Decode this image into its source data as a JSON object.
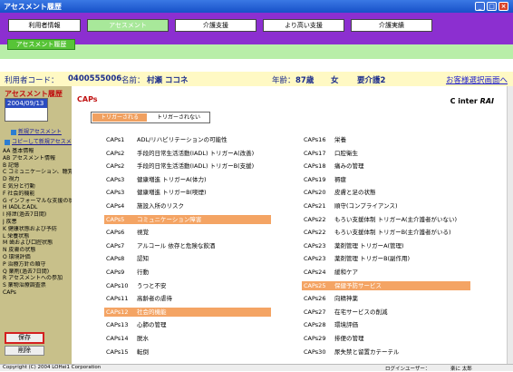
{
  "window": {
    "title": "アセスメント履歴"
  },
  "nav": {
    "items": [
      {
        "label": "利用者情報"
      },
      {
        "label": "アセスメント"
      },
      {
        "label": "介護支援"
      },
      {
        "label": "より高い支援"
      },
      {
        "label": "介護実績"
      }
    ],
    "active": "アセスメント"
  },
  "subnav": {
    "button": "アセスメント履歴"
  },
  "info": {
    "user_code_label": "利用者コード：",
    "user_code": "0400555006",
    "name_label": "名前：",
    "name": "村瀬 ココネ",
    "age_label": "年齢：",
    "age": "87歳",
    "sex": "女",
    "care_level": "要介護2",
    "customer_link": "お客様選択画面へ"
  },
  "sidebar": {
    "title": "アセスメント履歴",
    "date": "2004/09/13",
    "new_link": "新規アセスメント",
    "copy_link": "コピーして新規アセスメント",
    "menu": [
      "AA 基本情報",
      "AB アセスメント情報",
      "B 記憶",
      "C コミュニケーション、聴覚",
      "D 視力",
      "E 気分と行動",
      "F 社会的機能",
      "G インフォーマルな支援の状況",
      "H IADLとADL",
      "I 排泄(過去7日間)",
      "J 疾患",
      "K 健康状態および予防",
      "L 栄養状態",
      "M 歯および口腔状態",
      "N 皮膚の状態",
      "O 環境評価",
      "P 治療方針の順守",
      "Q 薬剤(過去7日間)",
      "R アセスメントへの参加",
      "S 薬物治療調査票",
      "CAPs"
    ],
    "save": "保存",
    "delete": "削除"
  },
  "main": {
    "title": "CAPs",
    "logo": "C inter",
    "logo_suffix": "RAI",
    "toggle": {
      "on": "トリガーされる",
      "off": "トリガーされない"
    },
    "left": [
      {
        "code": "CAPs1",
        "label": "ADL/リハビリテーションの可能性",
        "triggered": false
      },
      {
        "code": "CAPs2",
        "label": "手段的日常生活活動(IADL)  トリガーA(改善)",
        "triggered": false
      },
      {
        "code": "CAPs2",
        "label": "手段的日常生活活動(IADL)  トリガーB(支援)",
        "triggered": false
      },
      {
        "code": "CAPs3",
        "label": "健康増進  トリガーA(体力)",
        "triggered": false
      },
      {
        "code": "CAPs3",
        "label": "健康増進  トリガーB(喫煙)",
        "triggered": false
      },
      {
        "code": "CAPs4",
        "label": "施設入所のリスク",
        "triggered": false
      },
      {
        "code": "CAPs5",
        "label": "コミュニケーション障害",
        "triggered": true
      },
      {
        "code": "CAPs6",
        "label": "視覚",
        "triggered": false
      },
      {
        "code": "CAPs7",
        "label": "アルコール 依存と危険な飲酒",
        "triggered": false
      },
      {
        "code": "CAPs8",
        "label": "認知",
        "triggered": false
      },
      {
        "code": "CAPs9",
        "label": "行動",
        "triggered": false
      },
      {
        "code": "CAPs10",
        "label": "うつと不安",
        "triggered": false
      },
      {
        "code": "CAPs11",
        "label": "高齢者の虐待",
        "triggered": false
      },
      {
        "code": "CAPs12",
        "label": "社会的機能",
        "triggered": true
      },
      {
        "code": "CAPs13",
        "label": "心肺の管理",
        "triggered": false
      },
      {
        "code": "CAPs14",
        "label": "脱水",
        "triggered": false
      },
      {
        "code": "CAPs15",
        "label": "転倒",
        "triggered": false
      }
    ],
    "right": [
      {
        "code": "CAPs16",
        "label": "栄養",
        "triggered": false
      },
      {
        "code": "CAPs17",
        "label": "口腔衛生",
        "triggered": false
      },
      {
        "code": "CAPs18",
        "label": "痛みの管理",
        "triggered": false
      },
      {
        "code": "CAPs19",
        "label": "褥瘡",
        "triggered": false
      },
      {
        "code": "CAPs20",
        "label": "皮膚と足の状態",
        "triggered": false
      },
      {
        "code": "CAPs21",
        "label": "順守(コンプライアンス)",
        "triggered": false
      },
      {
        "code": "CAPs22",
        "label": "もろい支援体制  トリガーA(主介護者がいない)",
        "triggered": false
      },
      {
        "code": "CAPs22",
        "label": "もろい支援体制  トリガーB(主介護者がいる)",
        "triggered": false
      },
      {
        "code": "CAPs23",
        "label": "薬剤管理  トリガーA(管理)",
        "triggered": false
      },
      {
        "code": "CAPs23",
        "label": "薬剤管理  トリガーB(副作用)",
        "triggered": false
      },
      {
        "code": "CAPs24",
        "label": "緩和ケア",
        "triggered": false
      },
      {
        "code": "CAPs25",
        "label": "保健予防サービス",
        "triggered": true
      },
      {
        "code": "CAPs26",
        "label": "向精神薬",
        "triggered": false
      },
      {
        "code": "CAPs27",
        "label": "在宅サービスの削減",
        "triggered": false
      },
      {
        "code": "CAPs28",
        "label": "環境評価",
        "triggered": false
      },
      {
        "code": "CAPs29",
        "label": "排便の管理",
        "triggered": false
      },
      {
        "code": "CAPs30",
        "label": "尿失禁と留置カテーテル",
        "triggered": false
      }
    ]
  },
  "status": {
    "copyright": "Copyright (C) 2004 LOHei1 Corporation",
    "login_label": "ログインユーザー：",
    "login_user": "楽に  太郎"
  },
  "colors": {
    "triggered": "#f4a464",
    "nav": "#8c2fd0",
    "sidebar": "#c8c08a",
    "info": "#fff9c4"
  }
}
